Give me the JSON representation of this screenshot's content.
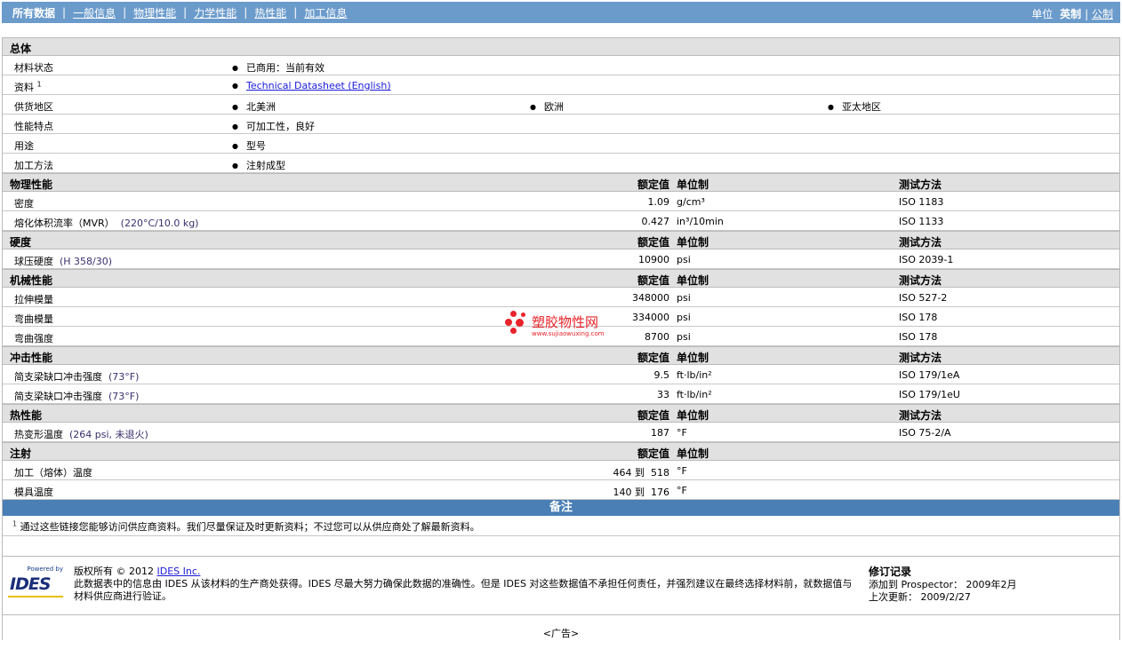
{
  "nav": {
    "tabs": [
      "所有数据",
      "一般信息",
      "物理性能",
      "力学性能",
      "热性能",
      "加工信息"
    ],
    "unit_label": "单位",
    "unit_current": "英制",
    "unit_alt": "公制"
  },
  "columns": {
    "value": "额定值",
    "unit": "单位制",
    "method": "测试方法"
  },
  "general": {
    "title": "总体",
    "rows": [
      {
        "label": "材料状态",
        "items": [
          "已商用：当前有效"
        ]
      },
      {
        "label": "资料",
        "sup": "1",
        "link": "Technical Datasheet (English)"
      },
      {
        "label": "供货地区",
        "items": [
          "北美洲",
          "欧洲",
          "亚太地区"
        ]
      },
      {
        "label": "性能特点",
        "items": [
          "可加工性，良好"
        ]
      },
      {
        "label": "用途",
        "items": [
          "型号"
        ]
      },
      {
        "label": "加工方法",
        "items": [
          "注射成型"
        ]
      }
    ]
  },
  "sections": [
    {
      "title": "物理性能",
      "method": true,
      "rows": [
        {
          "label": "密度",
          "cond": "",
          "value": "1.09",
          "unit": "g/cm³",
          "method": "ISO 1183"
        },
        {
          "label": "熔化体积流率（MVR）",
          "cond": "(220°C/10.0 kg)",
          "value": "0.427",
          "unit": "in³/10min",
          "method": "ISO 1133"
        }
      ]
    },
    {
      "title": "硬度",
      "method": true,
      "rows": [
        {
          "label": "球压硬度",
          "cond": "(H 358/30)",
          "value": "10900",
          "unit": "psi",
          "method": "ISO 2039-1"
        }
      ]
    },
    {
      "title": "机械性能",
      "method": true,
      "rows": [
        {
          "label": "拉伸模量",
          "cond": "",
          "value": "348000",
          "unit": "psi",
          "method": "ISO 527-2"
        },
        {
          "label": "弯曲模量",
          "cond": "",
          "value": "334000",
          "unit": "psi",
          "method": "ISO 178"
        },
        {
          "label": "弯曲强度",
          "cond": "",
          "value": "8700",
          "unit": "psi",
          "method": "ISO 178"
        }
      ]
    },
    {
      "title": "冲击性能",
      "method": true,
      "rows": [
        {
          "label": "简支梁缺口冲击强度",
          "cond": "(73°F)",
          "value": "9.5",
          "unit": "ft·lb/in²",
          "method": "ISO 179/1eA"
        },
        {
          "label": "简支梁缺口冲击强度",
          "cond": "(73°F)",
          "value": "33",
          "unit": "ft·lb/in²",
          "method": "ISO 179/1eU"
        }
      ]
    },
    {
      "title": "热性能",
      "method": true,
      "rows": [
        {
          "label": "热变形温度",
          "cond": "(264 psi, 未退火)",
          "value": "187",
          "unit": "°F",
          "method": "ISO 75-2/A"
        }
      ]
    },
    {
      "title": "注射",
      "method": false,
      "rows": [
        {
          "label": "加工（熔体）温度",
          "cond": "",
          "value": "464 到  518",
          "unit": "°F",
          "method": ""
        },
        {
          "label": "模具温度",
          "cond": "",
          "value": "140 到  176",
          "unit": "°F",
          "method": ""
        }
      ]
    }
  ],
  "notes": {
    "title": "备注",
    "sup": "1",
    "text": "通过这些链接您能够访问供应商资料。我们尽量保证及时更新资料；不过您可以从供应商处了解最新资料。"
  },
  "footer": {
    "logo_powered": "Powered by",
    "logo_name": "IDES",
    "copyright": "版权所有 © 2012",
    "company_link": "IDES Inc.",
    "disclaimer": "此数据表中的信息由 IDES 从该材料的生产商处获得。IDES 尽最大努力确保此数据的准确性。但是 IDES 对这些数据值不承担任何责任，并强烈建议在最终选择材料前，就数据值与材料供应商进行验证。",
    "rev_title": "修订记录",
    "rev_added": "添加到 Prospector： 2009年2月",
    "rev_updated": "上次更新： 2009/2/27"
  },
  "ad": "<广告>",
  "watermark": {
    "name": "塑胶物性网",
    "url": "www.sujiaowuxing.com"
  }
}
